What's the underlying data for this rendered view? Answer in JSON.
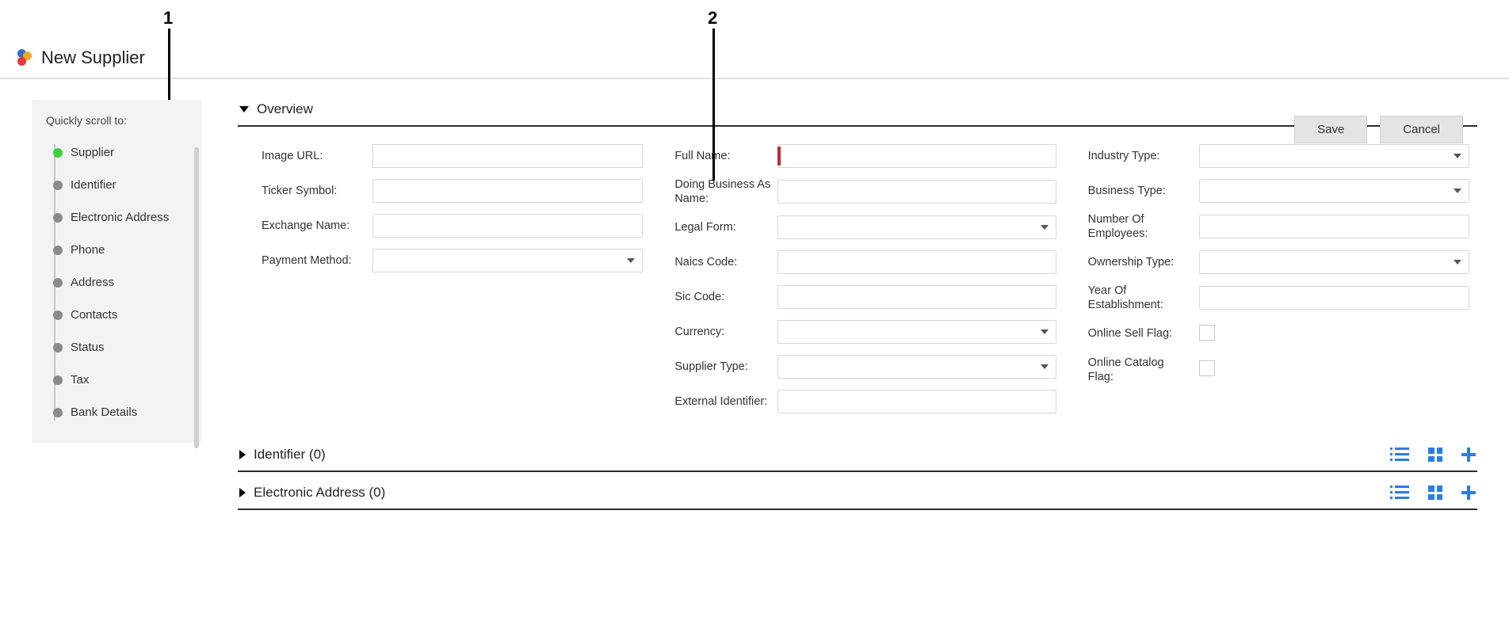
{
  "callouts": {
    "one": "1",
    "two": "2"
  },
  "header": {
    "title": "New Supplier"
  },
  "sidebar": {
    "title": "Quickly scroll to:",
    "items": [
      {
        "label": "Supplier",
        "active": true
      },
      {
        "label": "Identifier"
      },
      {
        "label": "Electronic Address"
      },
      {
        "label": "Phone"
      },
      {
        "label": "Address"
      },
      {
        "label": "Contacts"
      },
      {
        "label": "Status"
      },
      {
        "label": "Tax"
      },
      {
        "label": "Bank Details"
      }
    ]
  },
  "actions": {
    "save": "Save",
    "cancel": "Cancel"
  },
  "sections": {
    "overview": {
      "title": "Overview",
      "fields": {
        "image_url": {
          "label": "Image URL:",
          "type": "text"
        },
        "ticker_symbol": {
          "label": "Ticker Symbol:",
          "type": "text"
        },
        "exchange_name": {
          "label": "Exchange Name:",
          "type": "text"
        },
        "payment_method": {
          "label": "Payment Method:",
          "type": "select"
        },
        "full_name": {
          "label": "Full Name:",
          "type": "text",
          "required": true
        },
        "dba_name": {
          "label": "Doing Business As Name:",
          "type": "text"
        },
        "legal_form": {
          "label": "Legal Form:",
          "type": "select"
        },
        "naics_code": {
          "label": "Naics Code:",
          "type": "text"
        },
        "sic_code": {
          "label": "Sic Code:",
          "type": "text"
        },
        "currency": {
          "label": "Currency:",
          "type": "select"
        },
        "supplier_type": {
          "label": "Supplier Type:",
          "type": "select"
        },
        "external_identifier": {
          "label": "External Identifier:",
          "type": "text"
        },
        "industry_type": {
          "label": "Industry Type:",
          "type": "select"
        },
        "business_type": {
          "label": "Business Type:",
          "type": "select"
        },
        "num_employees": {
          "label": "Number Of Employees:",
          "type": "text"
        },
        "ownership_type": {
          "label": "Ownership Type:",
          "type": "select"
        },
        "year_establishment": {
          "label": "Year Of Establishment:",
          "type": "text"
        },
        "online_sell_flag": {
          "label": "Online Sell Flag:",
          "type": "checkbox"
        },
        "online_catalog_flag": {
          "label": "Online Catalog Flag:",
          "type": "checkbox"
        }
      }
    },
    "identifier": {
      "title": "Identifier (0)"
    },
    "electronic_address": {
      "title": "Electronic Address (0)"
    }
  }
}
